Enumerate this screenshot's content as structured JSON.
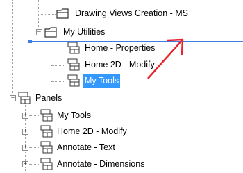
{
  "tree": {
    "items": [
      {
        "label": "Drawing Views Creation - MS",
        "expander": ""
      },
      {
        "label": "My Utilities",
        "expander": "−"
      },
      {
        "label": "Home - Properties",
        "expander": ""
      },
      {
        "label": "Home 2D - Modify",
        "expander": ""
      },
      {
        "label": "My Tools",
        "expander": ""
      },
      {
        "label": "Panels",
        "expander": "−"
      },
      {
        "label": "My Tools",
        "expander": "+"
      },
      {
        "label": "Home 2D - Modify",
        "expander": "+"
      },
      {
        "label": "Annotate - Text",
        "expander": "+"
      },
      {
        "label": "Annotate - Dimensions",
        "expander": "+"
      }
    ]
  },
  "annotation": {
    "arrow_color": "#e8232d",
    "drop_indicator_color": "#3c7ee8"
  }
}
